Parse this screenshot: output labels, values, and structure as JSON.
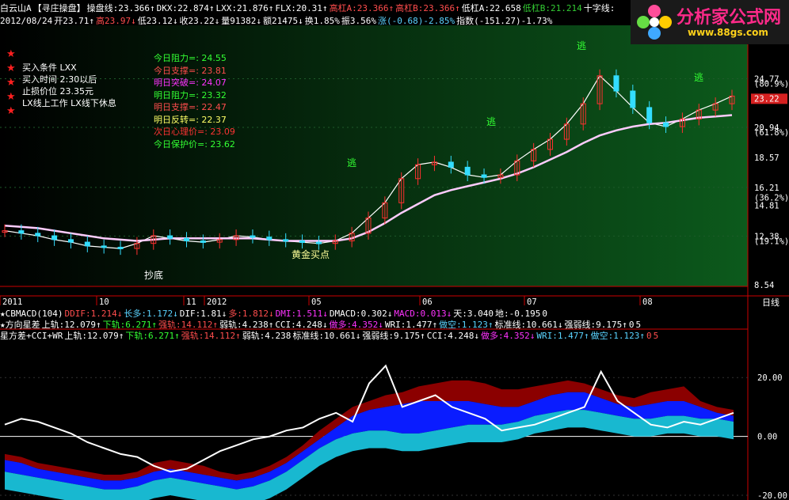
{
  "header": {
    "line1": [
      {
        "text": "白云山A",
        "color": "#ffffff"
      },
      {
        "text": "【寻庄操盘】",
        "color": "#ffffff"
      },
      {
        "text": "操盘线:23.366↑",
        "color": "#ffffff"
      },
      {
        "text": "DKX:22.874↑",
        "color": "#ffffff"
      },
      {
        "text": "LXX:21.876↑",
        "color": "#ffffff"
      },
      {
        "text": "FLX:20.31↑",
        "color": "#ffffff"
      },
      {
        "text": "高杠A:23.366↑",
        "color": "#ff4d4d"
      },
      {
        "text": "高杠B:23.366↑",
        "color": "#ff4d4d"
      },
      {
        "text": "低杠A:22.658",
        "color": "#ffffff"
      },
      {
        "text": "低杠B:21.214",
        "color": "#33cc33"
      },
      {
        "text": "十字线:",
        "color": "#ffffff"
      }
    ],
    "line2": [
      {
        "text": "2012/08/24",
        "color": "#ffffff"
      },
      {
        "text": "开23.71↑",
        "color": "#ffffff"
      },
      {
        "text": "高23.97↓",
        "color": "#ff4d4d"
      },
      {
        "text": "低23.12↓",
        "color": "#ffffff"
      },
      {
        "text": "收23.22↓",
        "color": "#ffffff"
      },
      {
        "text": "量91382↓",
        "color": "#ffffff"
      },
      {
        "text": "额21475↓",
        "color": "#ffffff"
      },
      {
        "text": "换1.85%",
        "color": "#ffffff"
      },
      {
        "text": "振3.56%",
        "color": "#ffffff"
      },
      {
        "text": "涨(-0.68)-2.85%",
        "color": "#5ad3ff"
      },
      {
        "text": "指数(-151.27)-1.73%",
        "color": "#ffffff"
      }
    ]
  },
  "logo": {
    "title": "分析家公式网",
    "url": "www.88gs.com"
  },
  "strategy_box": {
    "lines": [
      "买入条件      LXX",
      "买入时间      2:30以后",
      "止损价位      23.35元",
      "LX线上工作    LX线下休息"
    ],
    "stars": "★★★★★"
  },
  "levels": [
    {
      "text": "今日阻力=: 24.55",
      "color": "#33ff33"
    },
    {
      "text": "今日支撑=: 23.81",
      "color": "#ff4d4d"
    },
    {
      "text": "明日突破=: 24.07",
      "color": "#ff33ff"
    },
    {
      "text": "明日阻力=: 23.32",
      "color": "#33ff33"
    },
    {
      "text": "明日支撑=: 22.47",
      "color": "#ff4d4d"
    },
    {
      "text": "明日反转=: 22.37",
      "color": "#ffff66"
    },
    {
      "text": "次日心理价=: 23.09",
      "color": "#ff3333"
    },
    {
      "text": "今日保护价=: 23.62",
      "color": "#33ff33"
    }
  ],
  "annotations": {
    "escape": "逃",
    "bottom": "抄底",
    "golden_buy": "黄金买点"
  },
  "price_axis": {
    "labels": [
      "28.60",
      "24.77",
      "(80.9%)",
      "23.22",
      "20.94",
      "(61.8%)",
      "18.57",
      "16.21",
      "(36.2%)",
      "14.81",
      "12.38",
      "(19.1%)",
      "8.54"
    ],
    "current_price": "23.22"
  },
  "time_axis": {
    "labels": [
      "2011",
      "10",
      "11",
      "2012",
      "05",
      "06",
      "07",
      "08"
    ],
    "period": "日线"
  },
  "indicators": {
    "line1": [
      {
        "text": "★CBMACD(104)",
        "color": "#ffffff"
      },
      {
        "text": "DDIF:1.214↓",
        "color": "#ff4d4d"
      },
      {
        "text": "长多:1.172↓",
        "color": "#5ad3ff"
      },
      {
        "text": "DIF:1.81↓",
        "color": "#ffffff"
      },
      {
        "text": "多:1.812↓",
        "color": "#ff4d4d"
      },
      {
        "text": "DMI:1.511↓",
        "color": "#ff33ff"
      },
      {
        "text": "DMACD:0.302↓",
        "color": "#ffffff"
      },
      {
        "text": "MACD:0.013↓",
        "color": "#ff33ff"
      },
      {
        "text": "天:3.040",
        "color": "#ffffff"
      },
      {
        "text": "地:-0.195",
        "color": "#ffffff"
      },
      {
        "text": "0",
        "color": "#ffffff"
      }
    ],
    "line2": [
      {
        "text": "★方向星差",
        "color": "#ffffff"
      },
      {
        "text": "上轨:12.079↑",
        "color": "#ffffff"
      },
      {
        "text": "下轨:6.271↑",
        "color": "#33ff33"
      },
      {
        "text": "强轨:14.112↑",
        "color": "#ff4d4d"
      },
      {
        "text": "弱轨:4.238↑",
        "color": "#ffffff"
      },
      {
        "text": "CCI:4.248↓",
        "color": "#ffffff"
      },
      {
        "text": "做多:4.352↓",
        "color": "#ff33ff"
      },
      {
        "text": "WRI:1.477↑",
        "color": "#ffffff"
      },
      {
        "text": "做空:1.123↑",
        "color": "#5ad3ff"
      },
      {
        "text": "标准线:10.661↓",
        "color": "#ffffff"
      },
      {
        "text": "强弱线:9.175↑",
        "color": "#ffffff"
      },
      {
        "text": "0",
        "color": "#ffffff"
      },
      {
        "text": "5",
        "color": "#ffffff"
      }
    ],
    "line3": [
      {
        "text": "星方差+CCI+WR",
        "color": "#ffffff"
      },
      {
        "text": "上轨:12.079↑",
        "color": "#ffffff"
      },
      {
        "text": "下轨:6.271↑",
        "color": "#33ff33"
      },
      {
        "text": "强轨:14.112↑",
        "color": "#ff4d4d"
      },
      {
        "text": "弱轨:4.238",
        "color": "#ffffff"
      },
      {
        "text": "标准线:10.661↓",
        "color": "#ffffff"
      },
      {
        "text": "强弱线:9.175↑",
        "color": "#ffffff"
      },
      {
        "text": "CCI:4.248↓",
        "color": "#ffffff"
      },
      {
        "text": "做多:4.352↓",
        "color": "#ff33ff"
      },
      {
        "text": "WRI:1.477↑",
        "color": "#5ad3ff"
      },
      {
        "text": "做空:1.123↑",
        "color": "#5ad3ff"
      },
      {
        "text": "0",
        "color": "#ff4d4d"
      },
      {
        "text": "5",
        "color": "#ff4d4d"
      }
    ]
  },
  "lower_axis": {
    "labels": [
      "20.00",
      "0.00",
      "-20.00"
    ]
  },
  "chart_data": [
    {
      "type": "line",
      "title": "白云山A",
      "ylim": [
        8.54,
        28.6
      ],
      "series": [
        {
          "name": "操盘线",
          "values": [
            12.8,
            12.6,
            12.4,
            12.1,
            11.9,
            11.6,
            11.5,
            11.4,
            11.8,
            12.4,
            12.2,
            12.0,
            11.9,
            12.1,
            12.4,
            12.3,
            12.1,
            12.0,
            11.9,
            11.8,
            12.0,
            12.6,
            13.8,
            15.0,
            16.9,
            18.0,
            18.2,
            17.8,
            17.2,
            17.0,
            17.2,
            18.3,
            19.2,
            20.0,
            21.2,
            22.8,
            25.0,
            23.8,
            22.5,
            21.3,
            21.0,
            21.6,
            22.3,
            22.8,
            23.4
          ]
        },
        {
          "name": "LXX",
          "values": [
            13.2,
            13.1,
            13.0,
            12.8,
            12.6,
            12.4,
            12.2,
            12.1,
            12.0,
            12.1,
            12.2,
            12.2,
            12.2,
            12.2,
            12.2,
            12.2,
            12.1,
            12.0,
            12.0,
            12.0,
            12.0,
            12.2,
            12.7,
            13.4,
            14.2,
            14.9,
            15.6,
            16.0,
            16.3,
            16.6,
            16.9,
            17.3,
            17.8,
            18.4,
            19.0,
            19.7,
            20.3,
            20.7,
            21.0,
            21.2,
            21.3,
            21.5,
            21.7,
            21.8,
            21.9
          ]
        }
      ]
    },
    {
      "type": "area",
      "title": "星方差+CCI+WR",
      "ylim": [
        -20,
        30
      ],
      "x_count": 45,
      "series": [
        {
          "name": "强轨",
          "values": [
            -6,
            -7,
            -9,
            -10,
            -11,
            -12,
            -13,
            -13,
            -12,
            -9,
            -8,
            -9,
            -10,
            -12,
            -13,
            -12,
            -10,
            -7,
            -3,
            2,
            6,
            10,
            12,
            14,
            15,
            17,
            18,
            19,
            19,
            18,
            16,
            16,
            17,
            18,
            19,
            18,
            16,
            14,
            13,
            15,
            16,
            17,
            12,
            10,
            9
          ]
        },
        {
          "name": "上轨",
          "values": [
            -8,
            -9,
            -11,
            -12,
            -13,
            -14,
            -15,
            -15,
            -14,
            -12,
            -11,
            -12,
            -13,
            -14,
            -15,
            -14,
            -12,
            -9,
            -5,
            -1,
            3,
            7,
            9,
            10,
            11,
            12,
            12,
            12,
            12,
            11,
            10,
            10,
            12,
            14,
            15,
            15,
            13,
            11,
            10,
            11,
            12,
            12,
            10,
            8,
            7
          ]
        },
        {
          "name": "下轨",
          "values": [
            -12,
            -13,
            -14,
            -15,
            -16,
            -17,
            -18,
            -18,
            -17,
            -15,
            -14,
            -15,
            -16,
            -17,
            -18,
            -17,
            -15,
            -12,
            -8,
            -4,
            -1,
            1,
            2,
            2,
            1,
            1,
            2,
            3,
            4,
            4,
            4,
            5,
            7,
            8,
            9,
            9,
            8,
            7,
            6,
            6,
            7,
            7,
            6,
            6,
            5
          ]
        },
        {
          "name": "CCI",
          "values": [
            4,
            6,
            5,
            3,
            1,
            -2,
            -4,
            -6,
            -7,
            -10,
            -12,
            -11,
            -8,
            -5,
            -3,
            -1,
            0,
            2,
            3,
            6,
            8,
            5,
            18,
            24,
            10,
            12,
            14,
            10,
            8,
            6,
            2,
            3,
            4,
            6,
            8,
            10,
            22,
            12,
            8,
            4,
            3,
            5,
            4,
            6,
            8
          ]
        }
      ]
    }
  ]
}
